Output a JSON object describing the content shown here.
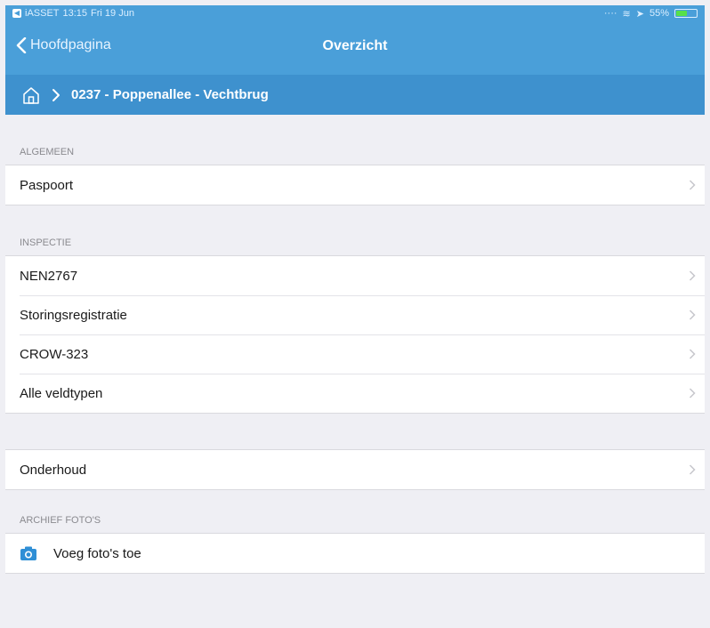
{
  "status_bar": {
    "carrier": "iASSET",
    "time": "13:15",
    "date": "Fri 19 Jun",
    "battery": "55%",
    "battery_level": 0.55
  },
  "nav": {
    "back_label": "Hoofdpagina",
    "title": "Overzicht"
  },
  "breadcrumb": {
    "current": "0237 - Poppenallee - Vechtbrug"
  },
  "sections": {
    "algemeen": {
      "header": "ALGEMEEN",
      "items": [
        "Paspoort"
      ]
    },
    "inspectie": {
      "header": "INSPECTIE",
      "items": [
        "NEN2767",
        "Storingsregistratie",
        "CROW-323",
        "Alle veldtypen"
      ]
    },
    "onderhoud": {
      "items": [
        "Onderhoud"
      ]
    },
    "archief": {
      "header": "ARCHIEF FOTO'S",
      "add_photo": "Voeg foto's toe"
    }
  },
  "colors": {
    "nav_blue": "#4a9fd9",
    "crumb_blue": "#3e91ce",
    "camera_blue": "#2f8fd6"
  },
  "icons": {
    "back": "chevron-left-icon",
    "home": "home-icon",
    "crumb_separator": "chevron-right-icon",
    "disclosure": "chevron-right-icon",
    "camera": "camera-icon"
  }
}
